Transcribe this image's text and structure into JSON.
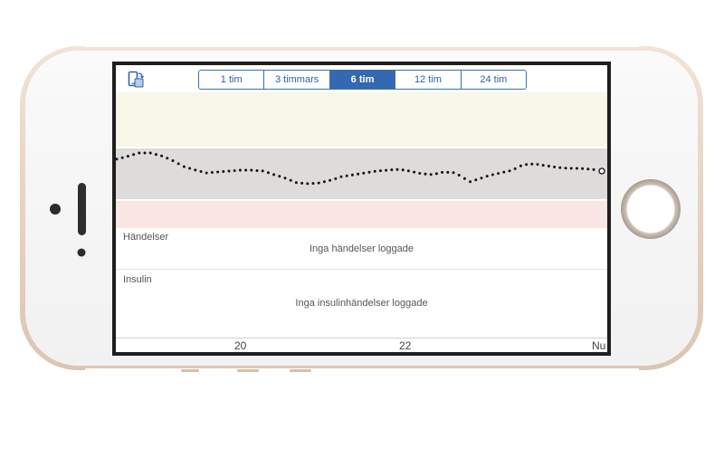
{
  "toolbar": {
    "rotate_icon": "rotate-device-icon",
    "ranges": [
      {
        "label": "1 tim",
        "active": false
      },
      {
        "label": "3 timmars",
        "active": false
      },
      {
        "label": "6 tim",
        "active": true
      },
      {
        "label": "12 tim",
        "active": false
      },
      {
        "label": "24 tim",
        "active": false
      }
    ]
  },
  "colors": {
    "accent": "#3468b0",
    "high_band": "#f8f7e8",
    "target_band": "#dedcdb",
    "low_band": "#fbe6e6",
    "trace": "#111111"
  },
  "events": {
    "label": "Händelser",
    "empty_message": "Inga händelser loggade"
  },
  "insulin": {
    "label": "Insulin",
    "empty_message": "Inga insulinhändelser loggade"
  },
  "xaxis": {
    "ticks": [
      "20",
      "22",
      "Nu"
    ]
  }
}
